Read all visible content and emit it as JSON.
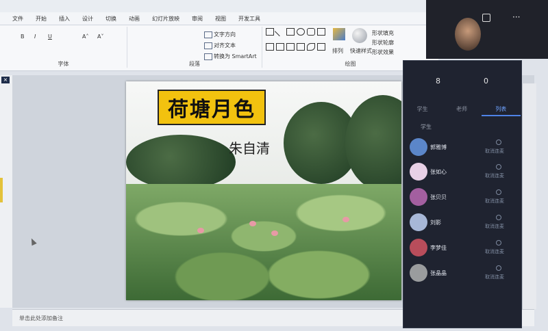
{
  "ribbon": {
    "tabs": [
      "文件",
      "开始",
      "插入",
      "设计",
      "切换",
      "动画",
      "幻灯片放映",
      "审阅",
      "视图",
      "开发工具"
    ],
    "font_group_label": "字体",
    "paragraph_group_label": "段落",
    "drawing_group_label": "绘图",
    "text_direction": "文字方向",
    "align_text": "对齐文本",
    "convert_smartart": "转换为 SmartArt",
    "shape_fill": "形状填充",
    "shape_outline": "形状轮廓",
    "shape_effects": "形状效果",
    "arrange": "排列",
    "quick_styles": "快速样式"
  },
  "slide": {
    "title": "荷塘月色",
    "author": "朱自清"
  },
  "notes": {
    "placeholder": "单击此处添加备注"
  },
  "panel": {
    "count_left": "8",
    "count_right": "0",
    "tabs": [
      "学生",
      "老师",
      "列表"
    ],
    "subheader": "学生",
    "action": "取消连麦",
    "participants": [
      {
        "name": "郭雅博",
        "color": "#5b86c9"
      },
      {
        "name": "张如心",
        "color": "#e8d0e6"
      },
      {
        "name": "张贝贝",
        "color": "#a35fa0"
      },
      {
        "name": "刘影",
        "color": "#a7b7d7"
      },
      {
        "name": "李梦佳",
        "color": "#b84d5b"
      },
      {
        "name": "张晶晶",
        "color": "#9a9c9e"
      }
    ]
  }
}
